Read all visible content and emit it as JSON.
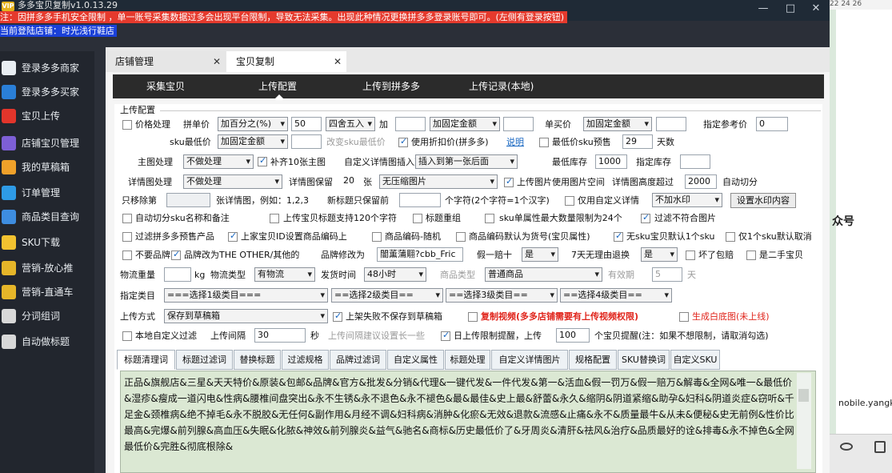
{
  "app": {
    "title": "多多宝贝复制v1.0.13.29",
    "vip": "VIP",
    "window_min": "—",
    "window_max": "□",
    "window_close": "✕"
  },
  "banner": {
    "warning": "注：因拼多多手机安全限制 ，单一账号采集数据过多会出现平台限制，导致无法采集。出现此种情况更换拼多多登录账号即可。(左侧有登录按钮)",
    "current_store": "当前登陆店铺：时光浅行鞋店"
  },
  "sidebar": {
    "items": [
      {
        "label": "登录多多商家",
        "icon": "monitor-icon",
        "color": "#e9eef3"
      },
      {
        "label": "登录多多买家",
        "icon": "phone-icon",
        "color": "#2a7fd8"
      },
      {
        "label": "宝贝上传",
        "icon": "cloud-upload-icon",
        "color": "#e2352b"
      },
      {
        "label": "店铺宝贝管理",
        "icon": "user-icon",
        "color": "#7d5fd6"
      },
      {
        "label": "我的草稿箱",
        "icon": "chart-icon",
        "color": "#f0a12a"
      },
      {
        "label": "订单管理",
        "icon": "cart-icon",
        "color": "#2e9be6"
      },
      {
        "label": "商品类目查询",
        "icon": "grid-icon",
        "color": "#3e8de0"
      },
      {
        "label": "SKU下载",
        "icon": "download-icon",
        "color": "#f2c230"
      },
      {
        "label": "营销-放心推",
        "icon": "promo-icon",
        "color": "#e6b629"
      },
      {
        "label": "营销-直通车",
        "icon": "promo2-icon",
        "color": "#e6b629"
      },
      {
        "label": "分词组词",
        "icon": "hammer-icon",
        "color": "#d8d8d8"
      },
      {
        "label": "自动做标题",
        "icon": "list-icon",
        "color": "#d8d8d8"
      }
    ]
  },
  "right": {
    "top": "22   24   26",
    "text1": "众号",
    "text2": "nobile.yangke"
  },
  "tabs": [
    {
      "label": "店铺管理",
      "close": "✕"
    },
    {
      "label": "宝贝复制",
      "close": "✕"
    }
  ],
  "nav": [
    "采集宝贝",
    "上传配置",
    "上传到拼多多",
    "上传记录(本地)"
  ],
  "form": {
    "section": "上传配置",
    "r1": {
      "price": "价格处理",
      "pin": "拼单价",
      "pin_sel": "加百分之(%)",
      "pin_val": "50",
      "round": "四舍五入",
      "add": "加",
      "add_sel": "加固定金额",
      "single": "单买价",
      "single_sel": "加固定金额",
      "ref": "指定参考价",
      "ref_val": "0"
    },
    "r2": {
      "sku_min": "sku最低价",
      "sku_sel": "加固定金额",
      "note": "改变sku最低价",
      "discount": "使用折扣价(拼多多)",
      "help": "说明",
      "min_presale": "最低价sku预售",
      "days_val": "29",
      "days": "天数"
    },
    "r3": {
      "main": "主图处理",
      "main_sel": "不做处理",
      "fill": "补齐10张主图",
      "custom": "自定义详情图插入到",
      "custom_sel": "插入到第一张后面",
      "stock": "最低库存",
      "stock_val": "1000",
      "given": "指定库存"
    },
    "r4": {
      "detail": "详情图处理",
      "detail_sel": "不做处理",
      "keep": "详情图保留",
      "keep_val": "20",
      "zhang": "张",
      "compress": "无压缩图片",
      "space": "上传图片使用图片空间",
      "height": "详情图高度超过",
      "height_val": "2000",
      "cut": "自动切分"
    },
    "r5": {
      "only_move": "只移除第",
      "example": "张详情图，例如：1,2,3",
      "name_keep": "新标题只保留前",
      "chars": "个字符(2个字符=1个汉字)",
      "only_custom": "仅用自定义详情",
      "wm_sel": "不加水印",
      "wm_btn": "设置水印内容"
    },
    "r6": {
      "a": "自动切分sku名称和备注",
      "b": "上传宝贝标题支持120个字符",
      "c": "标题重组",
      "d": "sku单属性最大数量限制为24个",
      "e": "过滤不符合图片"
    },
    "r7": {
      "a": "过滤拼多多预售产品",
      "b": "上家宝贝ID设置商品编码上",
      "c": "商品编码-随机",
      "d": "商品编码默认为货号(宝贝属性)",
      "e": "无sku宝贝默认1个sku",
      "f": "仅1个sku默认取消"
    },
    "r8": {
      "a": "不要品牌",
      "b": "品牌改为THE OTHER/其他的",
      "c": "品牌修改为",
      "brand_val": "闇薫蒲翢?cbb_Fric",
      "d": "假一赔十",
      "d_sel": "是",
      "e": "7天无理由退换",
      "e_sel": "是",
      "f": "坏了包赔",
      "g": "是二手宝贝"
    },
    "r9": {
      "weight": "物流重量",
      "kg": "kg",
      "ltype": "物流类型",
      "ltype_sel": "有物流",
      "ship": "发货时间",
      "ship_sel": "48小时",
      "ptype": "商品类型",
      "ptype_sel": "普通商品",
      "valid": "有效期",
      "valid_val": "5",
      "day": "天"
    },
    "r10": {
      "cat": "指定类目",
      "c1": "===选择1级类目===",
      "c2": "==选择2级类目==",
      "c3": "==选择3级类目==",
      "c4": "==选择4级类目=="
    },
    "r11": {
      "mode": "上传方式",
      "mode_sel": "保存到草稿箱",
      "fail": "上架失败不保存到草稿箱",
      "video": "复制视频(多多店铺需要有上传视频权限)",
      "white": "生成白底图(未上线)"
    },
    "r12": {
      "local": "本地自定义过滤",
      "interval": "上传间隔",
      "interval_val": "30",
      "sec": "秒",
      "suggest": "上传间隔建议设置长一些",
      "daily": "日上传限制提醒，上传",
      "daily_val": "100",
      "remind": "个宝贝提醒(注：如果不想限制，请取消勾选)"
    }
  },
  "bottom_tabs": [
    "标题清理词",
    "标题过滤词",
    "替换标题",
    "过滤规格",
    "品牌过滤词",
    "自定义属性",
    "标题处理",
    "自定义详情图片",
    "规格配置",
    "SKU替换词",
    "自定义SKU"
  ],
  "filter_text": "正品&旗舰店&三星&天天特价&原装&包邮&品牌&官方&批发&分销&代理&一键代发&一件代发&第一&活血&假一罚万&假一赔万&解毒&全网&唯一&最低价&湿疹&瘦成一道闪电&性病&腰椎间盘突出&永不生锈&永不退色&永不褪色&最&最佳&史上最&舒蕾&永久&缩阴&阴道紧缩&助孕&妇科&阴道炎症&窃听&千足金&颈椎病&绝不掉毛&永不脱胶&无任何&副作用&月经不调&妇科病&消肿&化瘀&无效&退款&流感&止痛&永不&质量最牛&从未&便秘&史无前例&性价比最高&完爆&前列腺&高血压&失眠&化脓&神效&前列腺炎&益气&驰名&商标&历史最低价了&牙周炎&清肝&祛风&治疗&品质最好的诠&排毒&永不掉色&全网最低价&完胜&彻底根除&"
}
